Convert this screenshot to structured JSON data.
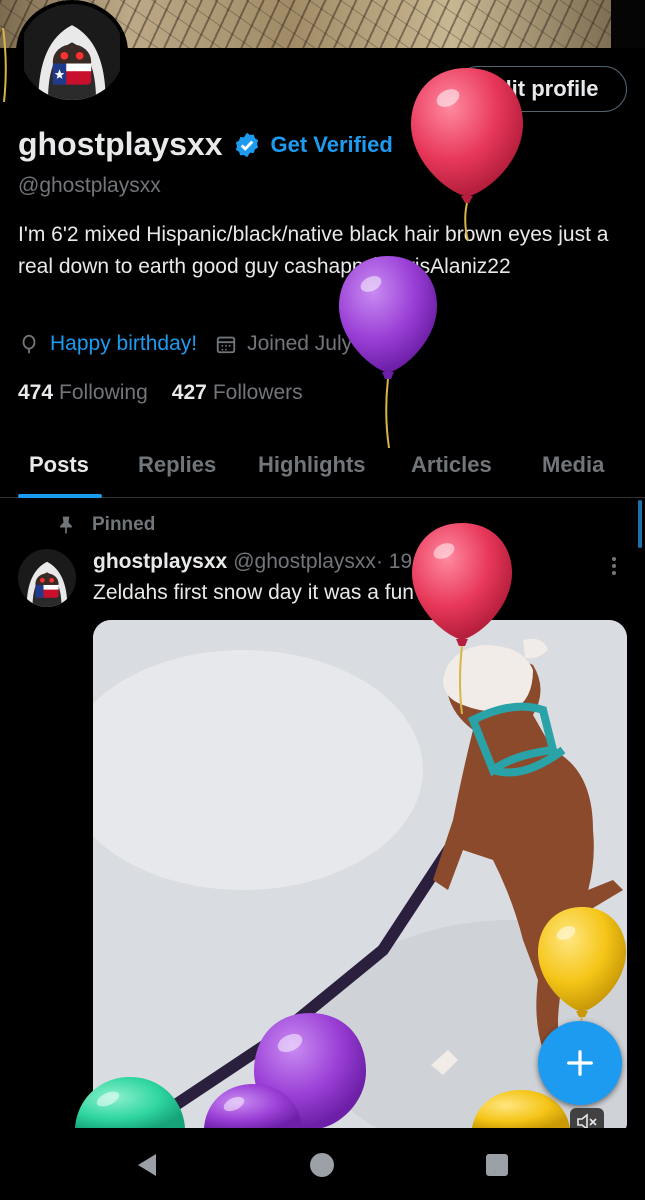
{
  "profile": {
    "display_name": "ghostplaysxx",
    "handle": "@ghostplaysxx",
    "get_verified_label": "Get Verified",
    "edit_profile_label": "Edit profile",
    "bio": "I'm 6'2 mixed Hispanic/black/native black hair brown eyes just a real down to earth good guy cashapp $ChrisAlaniz22",
    "birthday_label": "Happy birthday!",
    "joined_label": "Joined July 2014",
    "following_count": "474",
    "following_label": "Following",
    "followers_count": "427",
    "followers_label": "Followers"
  },
  "tabs": [
    {
      "label": "Posts",
      "active": true
    },
    {
      "label": "Replies",
      "active": false
    },
    {
      "label": "Highlights",
      "active": false
    },
    {
      "label": "Articles",
      "active": false
    },
    {
      "label": "Media",
      "active": false
    }
  ],
  "post": {
    "pinned_label": "Pinned",
    "author": "ghostplaysxx",
    "handle": "@ghostplaysxx",
    "date": " · 19 Mar 21",
    "text": "Zeldahs first snow day it was a fun day"
  },
  "colors": {
    "accent": "#1d9bf0",
    "background": "#000000",
    "muted_text": "#71767b",
    "balloon_red": "#e8385a",
    "balloon_purple": "#9a3fd6",
    "balloon_yellow": "#f5c518",
    "balloon_green": "#2fd6a0"
  },
  "icons": {
    "verified": "verified-badge-icon",
    "birthday": "balloon-icon",
    "calendar": "calendar-icon",
    "pin": "pin-icon",
    "more": "more-vertical-icon",
    "compose": "plus-icon",
    "mute": "speaker-muted-icon",
    "nav_back": "back-triangle-icon",
    "nav_home": "home-circle-icon",
    "nav_recents": "recents-square-icon"
  }
}
